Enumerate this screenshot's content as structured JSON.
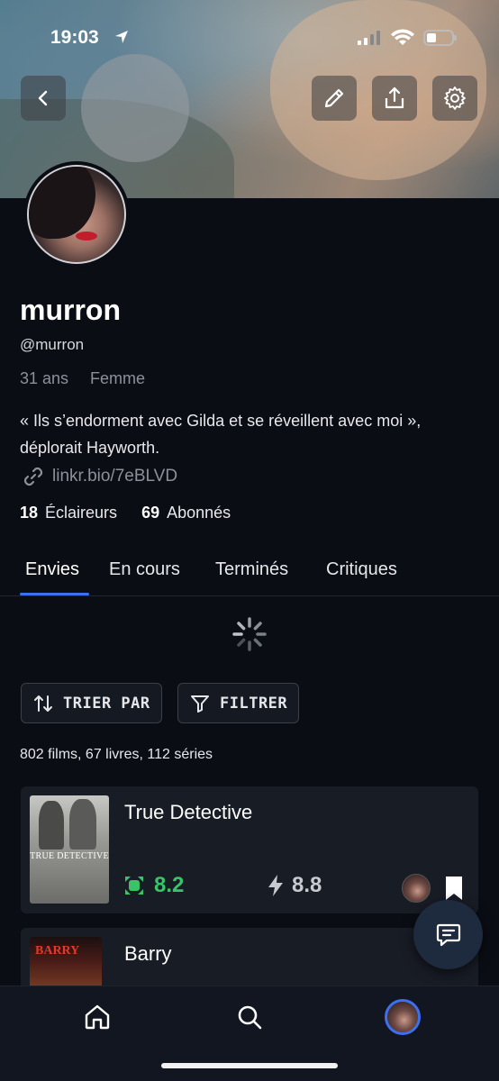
{
  "status_bar": {
    "time": "19:03"
  },
  "profile": {
    "username": "murron",
    "handle": "@murron",
    "age": "31 ans",
    "gender": "Femme",
    "bio": "« Ils s’endorment avec Gilda et se réveillent avec moi », déplorait Hayworth.",
    "link": "linkr.bio/7eBLVD",
    "scouts_count": "18",
    "scouts_label": "Éclaireurs",
    "followers_count": "69",
    "followers_label": "Abonnés"
  },
  "tabs": [
    {
      "label": "Envies",
      "active": true
    },
    {
      "label": "En cours",
      "active": false
    },
    {
      "label": "Terminés",
      "active": false
    },
    {
      "label": "Critiques",
      "active": false
    }
  ],
  "toolbar": {
    "sort_label": "TRIER PAR",
    "filter_label": "FILTRER"
  },
  "counts": "802 films, 67 livres, 112 séries",
  "items": [
    {
      "title": "True Detective",
      "poster_text": "TRUE DETECTIVE",
      "score_community": "8.2",
      "score_lightning": "8.8"
    },
    {
      "title": "Barry",
      "poster_text": "BARRY"
    }
  ],
  "icons": {
    "back": "chevron-left-icon",
    "edit": "pencil-icon",
    "share": "share-icon",
    "settings": "gear-icon",
    "link": "link-icon",
    "sort": "sort-arrows-icon",
    "filter": "funnel-icon",
    "chat": "chat-icon",
    "home": "home-icon",
    "search": "search-icon"
  },
  "colors": {
    "accent": "#3d6ff0",
    "score_green": "#39c46a",
    "background": "#0a0d14"
  }
}
